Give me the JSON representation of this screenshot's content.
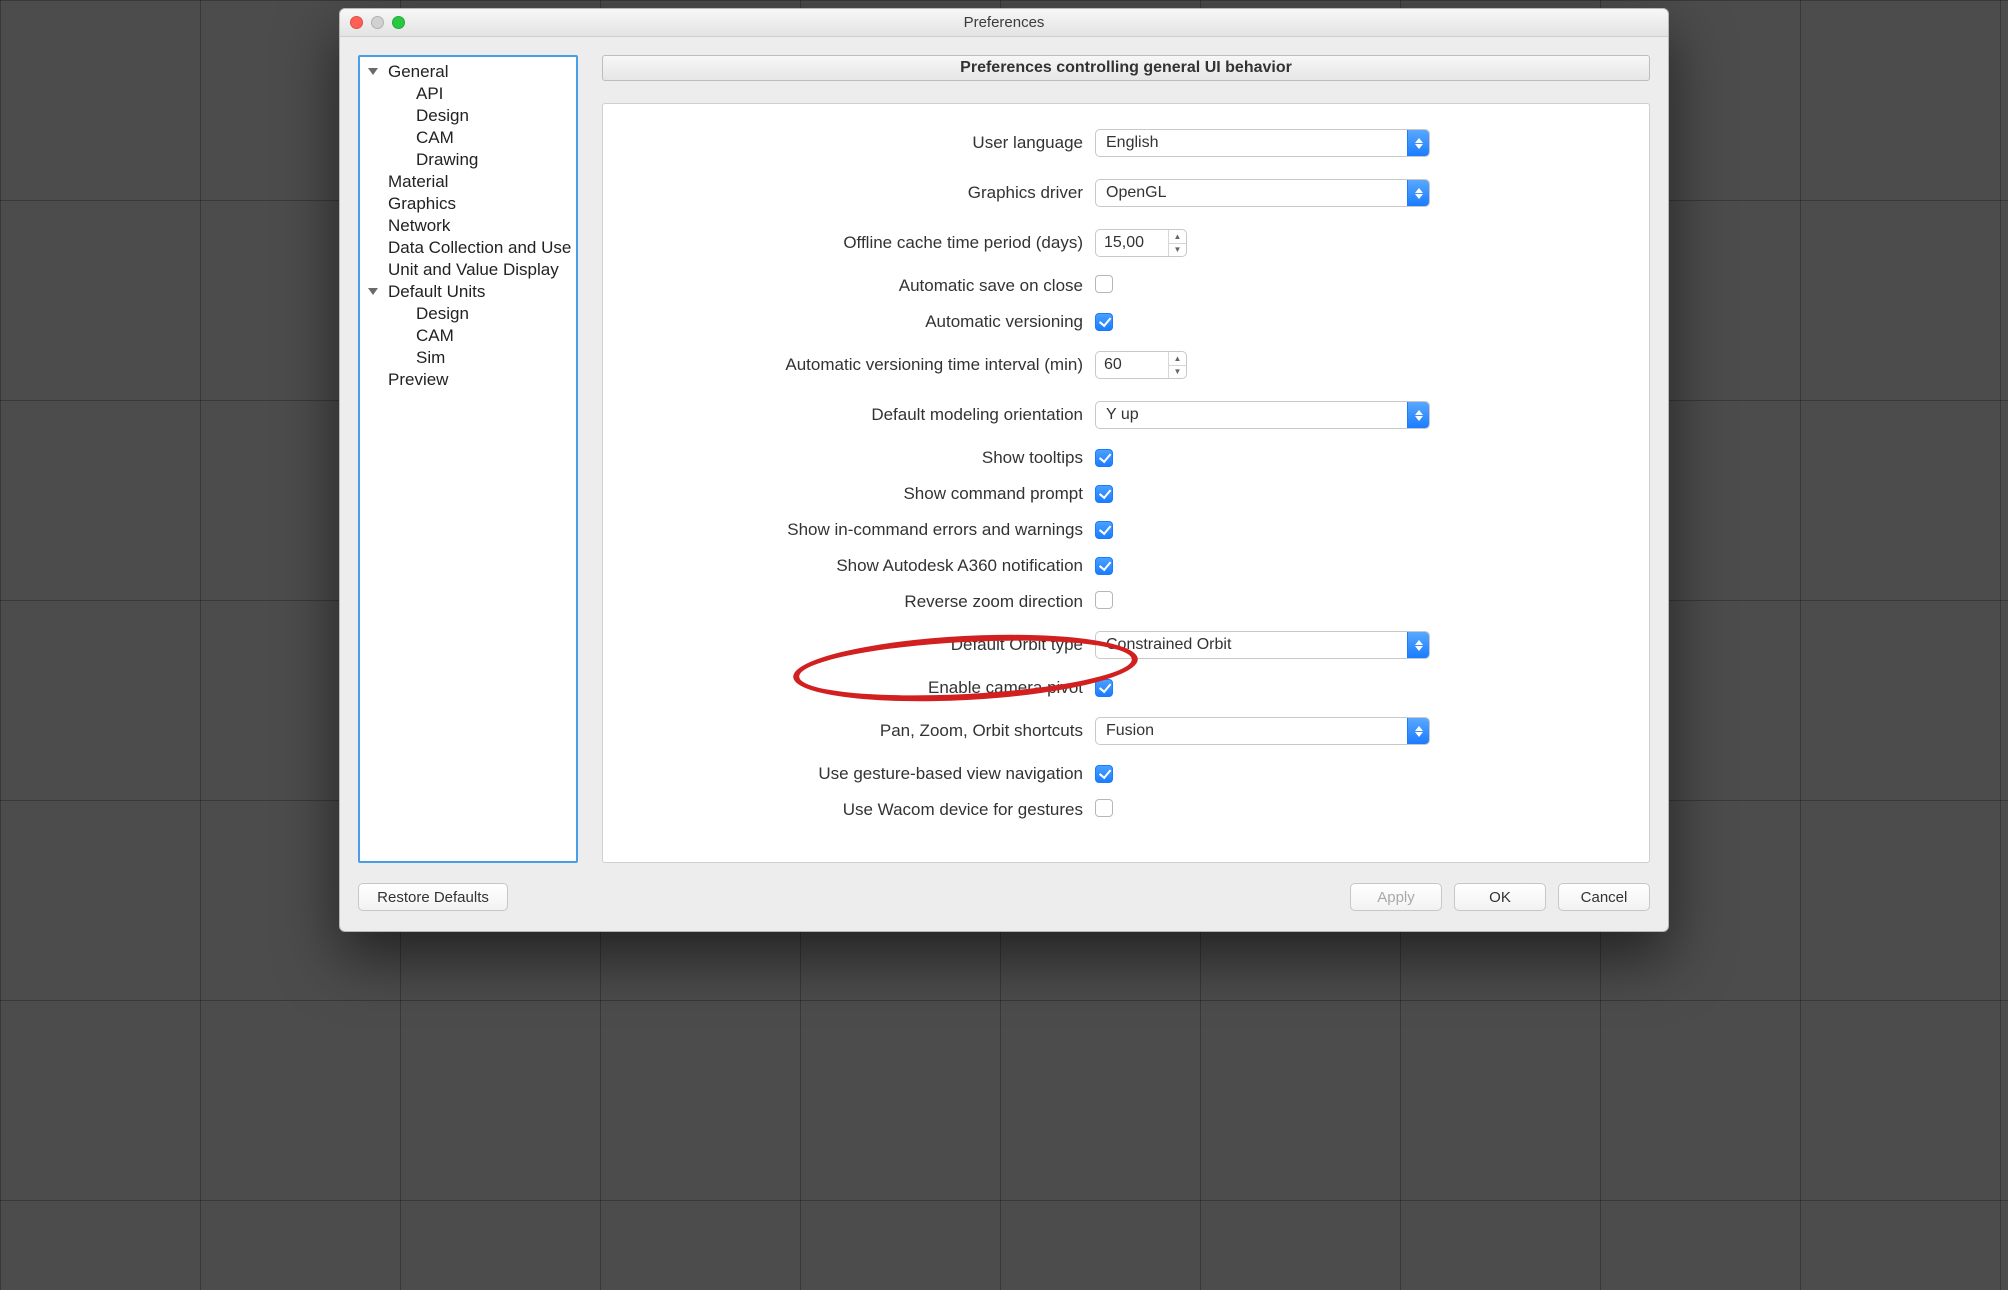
{
  "window": {
    "title": "Preferences"
  },
  "tree": {
    "general": "General",
    "general_children": {
      "api": "API",
      "design": "Design",
      "cam": "CAM",
      "drawing": "Drawing"
    },
    "material": "Material",
    "graphics": "Graphics",
    "network": "Network",
    "data_collection": "Data Collection and Use",
    "unit_value": "Unit and Value Display",
    "default_units": "Default Units",
    "default_units_children": {
      "design": "Design",
      "cam": "CAM",
      "sim": "Sim"
    },
    "preview": "Preview"
  },
  "panel": {
    "header": "Preferences controlling general UI behavior"
  },
  "labels": {
    "user_language": "User language",
    "graphics_driver": "Graphics driver",
    "offline_cache": "Offline cache time period (days)",
    "auto_save": "Automatic save on close",
    "auto_versioning": "Automatic versioning",
    "versioning_interval": "Automatic versioning time interval (min)",
    "modeling_orientation": "Default modeling orientation",
    "show_tooltips": "Show tooltips",
    "show_cmd_prompt": "Show command prompt",
    "show_incmd_errors": "Show in-command errors and warnings",
    "show_a360": "Show Autodesk A360 notification",
    "reverse_zoom": "Reverse zoom direction",
    "default_orbit": "Default Orbit type",
    "camera_pivot": "Enable camera pivot",
    "pzo_shortcuts": "Pan, Zoom, Orbit shortcuts",
    "gesture_nav": "Use gesture-based view navigation",
    "wacom": "Use Wacom device for gestures"
  },
  "values": {
    "user_language": "English",
    "graphics_driver": "OpenGL",
    "offline_cache": "15,00",
    "auto_save": false,
    "auto_versioning": true,
    "versioning_interval": "60",
    "modeling_orientation": "Y up",
    "show_tooltips": true,
    "show_cmd_prompt": true,
    "show_incmd_errors": true,
    "show_a360": true,
    "reverse_zoom": false,
    "default_orbit": "Constrained Orbit",
    "camera_pivot": true,
    "pzo_shortcuts": "Fusion",
    "gesture_nav": true,
    "wacom": false
  },
  "footer": {
    "restore": "Restore Defaults",
    "apply": "Apply",
    "ok": "OK",
    "cancel": "Cancel"
  }
}
